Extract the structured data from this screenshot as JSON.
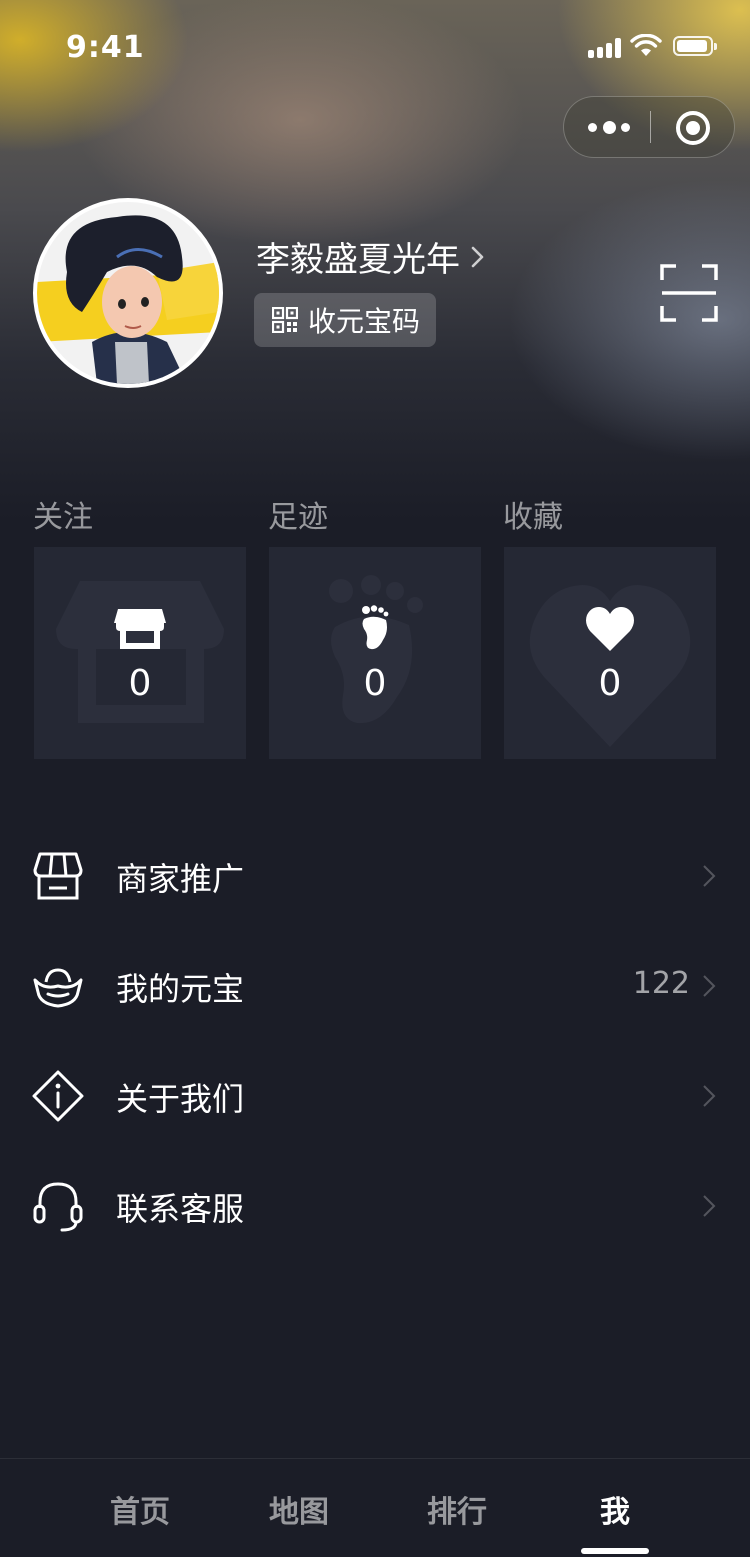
{
  "status_bar": {
    "time": "9:41"
  },
  "profile": {
    "username": "李毅盛夏光年",
    "qr_label": "收元宝码"
  },
  "stats": [
    {
      "label": "关注",
      "count": "0",
      "icon": "store-icon"
    },
    {
      "label": "足迹",
      "count": "0",
      "icon": "footprint-icon"
    },
    {
      "label": "收藏",
      "count": "0",
      "icon": "heart-icon"
    }
  ],
  "menu": [
    {
      "label": "商家推广",
      "value": "",
      "icon": "shop-icon"
    },
    {
      "label": "我的元宝",
      "value": "122",
      "icon": "ingot-icon"
    },
    {
      "label": "关于我们",
      "value": "",
      "icon": "info-diamond-icon"
    },
    {
      "label": "联系客服",
      "value": "",
      "icon": "headset-icon"
    }
  ],
  "tabbar": {
    "items": [
      "首页",
      "地图",
      "排行",
      "我"
    ],
    "active_index": 3
  },
  "colors": {
    "background": "#1b1d27",
    "card": "#252834"
  }
}
